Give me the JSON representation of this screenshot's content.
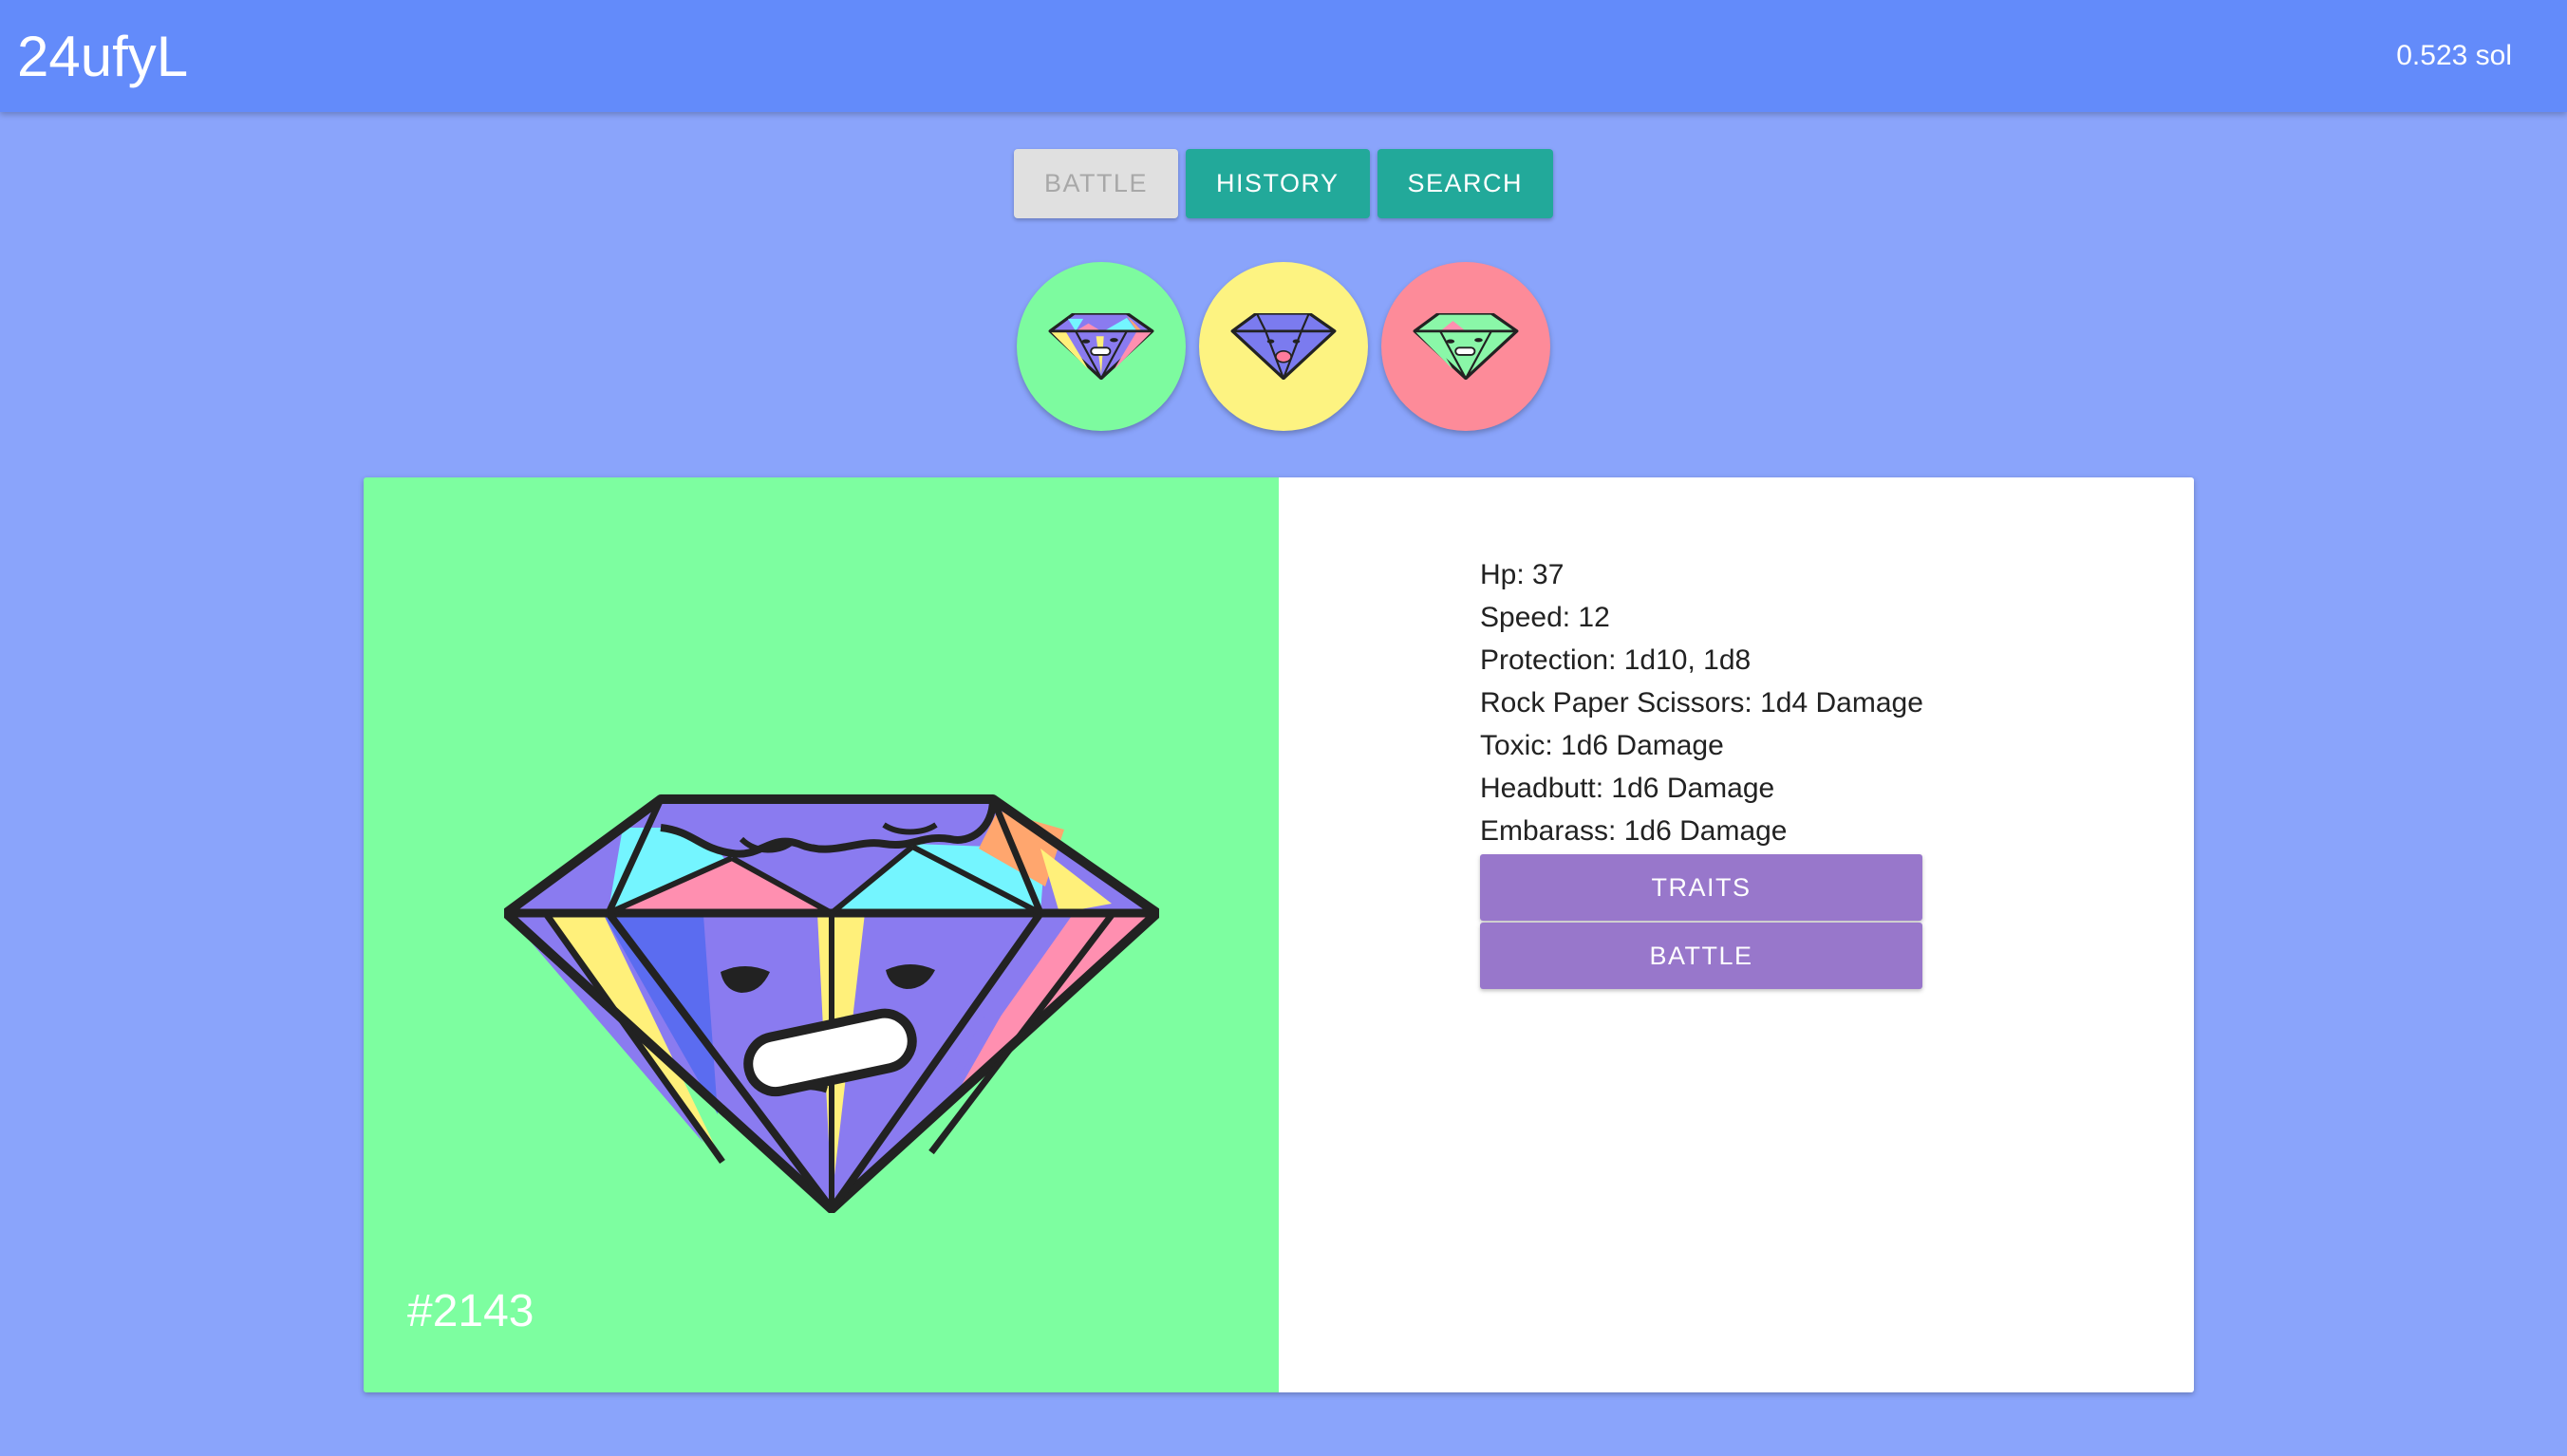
{
  "app": {
    "title": "24ufyL",
    "balance": "0.523 sol"
  },
  "tabs": [
    {
      "label": "BATTLE",
      "active": true
    },
    {
      "label": "HISTORY",
      "active": false
    },
    {
      "label": "SEARCH",
      "active": false
    }
  ],
  "selector": [
    {
      "name": "gem-avatar",
      "background": "#7dfb9f",
      "selected": true
    },
    {
      "name": "gem-avatar",
      "background": "#fdf381",
      "selected": false
    },
    {
      "name": "gem-avatar",
      "background": "#fd8b99",
      "selected": false
    }
  ],
  "card": {
    "id_label": "#2143",
    "image_background": "#7dfea0",
    "stats": [
      "Hp: 37",
      "Speed: 12",
      "Protection: 1d10, 1d8",
      "Rock Paper Scissors: 1d4 Damage",
      "Toxic: 1d6 Damage",
      "Headbutt: 1d6 Damage",
      "Embarass: 1d6 Damage"
    ],
    "traits_label": "TRAITS",
    "battle_label": "BATTLE"
  },
  "colors": {
    "page_bg": "#8aa4fb",
    "appbar_bg": "#638bfa",
    "tab_accent": "#22a99a",
    "action_accent": "#9877cb"
  }
}
